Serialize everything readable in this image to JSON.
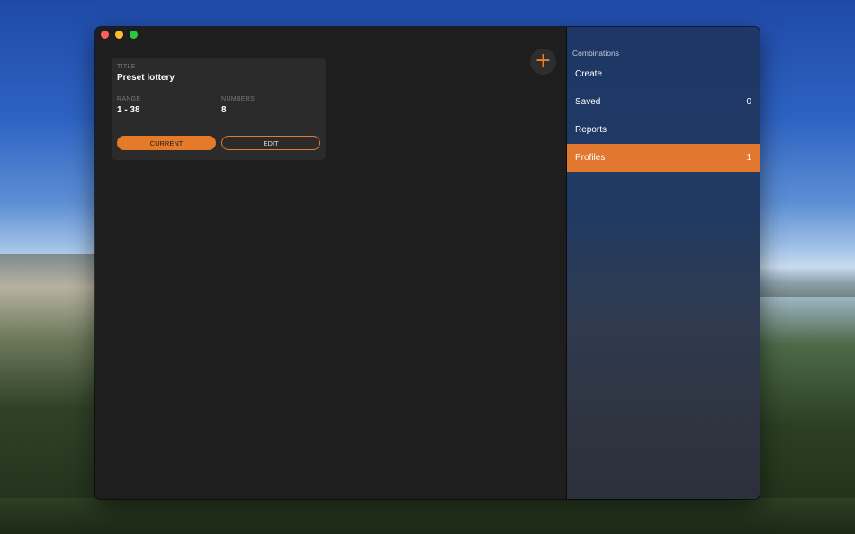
{
  "window": {
    "title": ""
  },
  "main": {
    "add_icon": "plus-icon",
    "add_symbol": "+",
    "card": {
      "title_label": "TITLE",
      "title_value": "Preset lottery",
      "range_label": "RANGE",
      "range_value": "1 - 38",
      "numbers_label": "NUMBERS",
      "numbers_value": "8",
      "current_button": "CURRENT",
      "edit_button": "EDIT"
    }
  },
  "sidebar": {
    "header": "Combinations",
    "items": [
      {
        "label": "Create",
        "count": ""
      },
      {
        "label": "Saved",
        "count": "0"
      },
      {
        "label": "Reports",
        "count": ""
      },
      {
        "label": "Profiles",
        "count": "1",
        "active": true
      }
    ]
  },
  "colors": {
    "accent": "#e57a2b",
    "card_bg": "#2b2b2b",
    "window_bg": "#1e1e1e"
  }
}
